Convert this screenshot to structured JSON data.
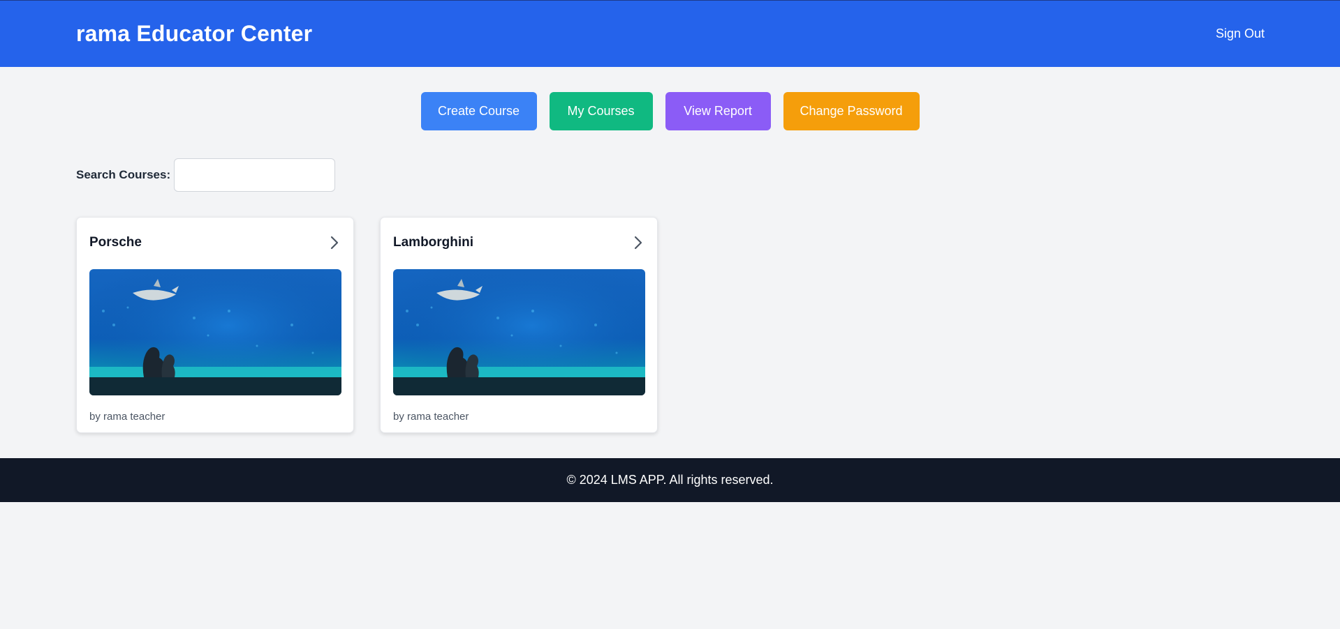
{
  "header": {
    "title": "rama Educator Center",
    "sign_out": "Sign Out"
  },
  "actions": {
    "create_course": "Create Course",
    "my_courses": "My Courses",
    "view_report": "View Report",
    "change_password": "Change Password"
  },
  "search": {
    "label": "Search Courses:",
    "value": "",
    "placeholder": ""
  },
  "courses": [
    {
      "title": "Porsche",
      "author": "by rama teacher",
      "icon": "chevron-right-icon"
    },
    {
      "title": "Lamborghini",
      "author": "by rama teacher",
      "icon": "chevron-right-icon"
    }
  ],
  "footer": {
    "text": "© 2024 LMS APP. All rights reserved."
  },
  "colors": {
    "header": "#2563eb",
    "create": "#3b82f6",
    "my_courses": "#10b981",
    "view_report": "#8b5cf6",
    "change_password": "#f59e0b",
    "footer": "#111827"
  }
}
